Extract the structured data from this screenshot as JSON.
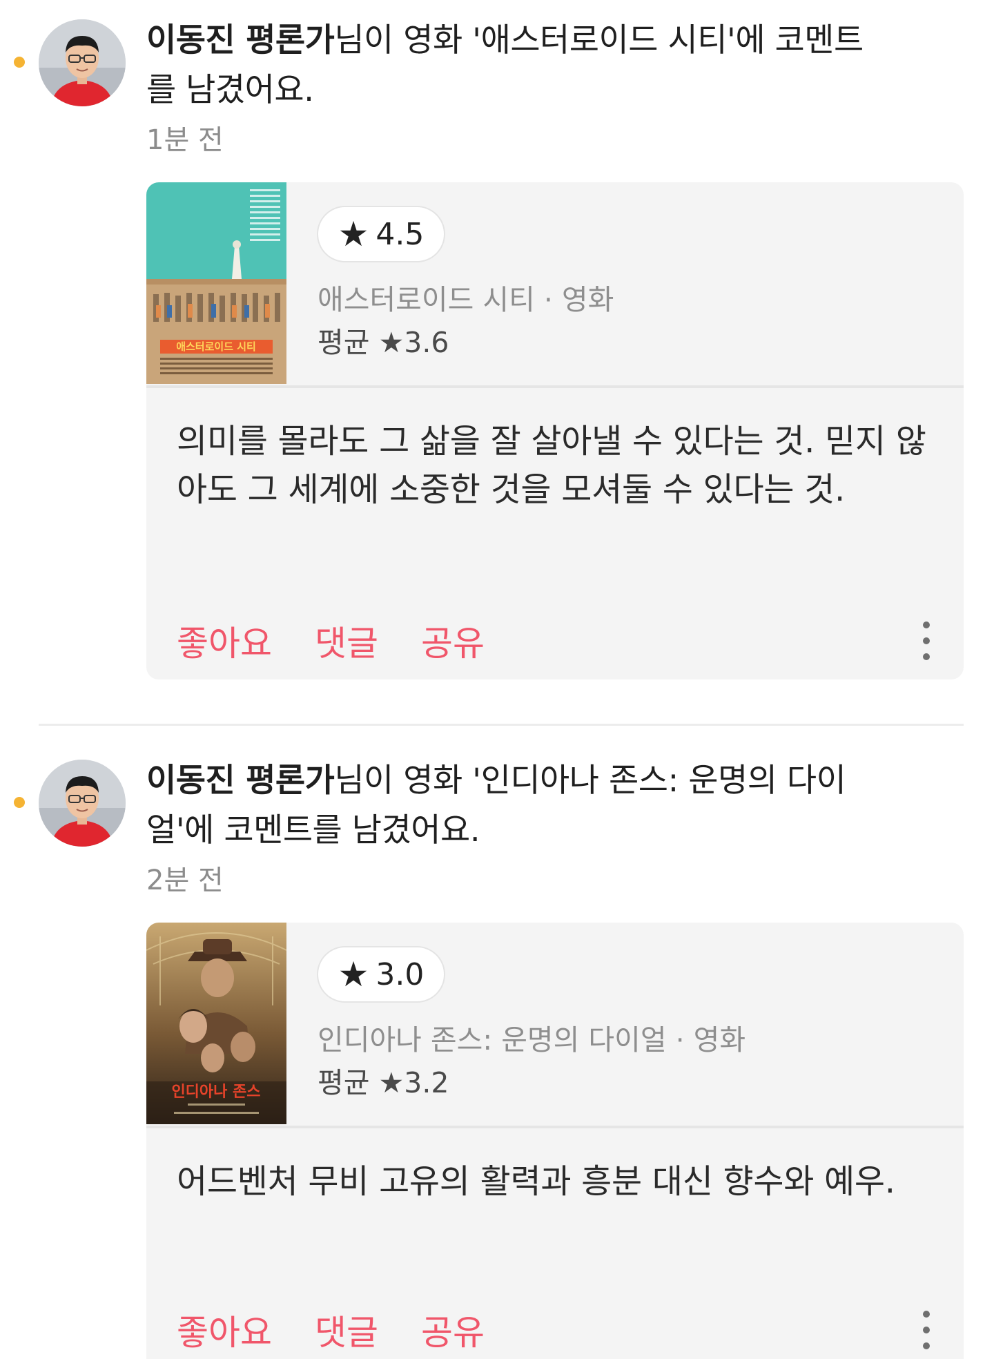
{
  "feed": {
    "items": [
      {
        "author": "이동진 평론가",
        "headline_rest": "님이 영화 '애스터로이드 시티'에 코멘트를 남겼어요.",
        "time": "1분 전",
        "rating": "4.5",
        "star": "★",
        "movie_meta": "애스터로이드 시티 · 영화",
        "avg": "평균 ★3.6",
        "poster_title": "애스터로이드 시티",
        "comment": "의미를 몰라도 그 삶을 잘 살아낼 수 있다는 것. 믿지 않아도 그 세계에 소중한 것을 모셔둘 수 있다는 것.",
        "like_label": "좋아요",
        "comment_label": "댓글",
        "share_label": "공유"
      },
      {
        "author": "이동진 평론가",
        "headline_rest": "님이 영화 '인디아나 존스: 운명의 다이얼'에 코멘트를 남겼어요.",
        "time": "2분 전",
        "rating": "3.0",
        "star": "★",
        "movie_meta": "인디아나 존스: 운명의 다이얼 · 영화",
        "avg": "평균 ★3.2",
        "poster_title": "인디아나 존스",
        "comment": "어드벤처 무비 고유의 활력과 흥분 대신 향수와 예우.",
        "like_label": "좋아요",
        "comment_label": "댓글",
        "share_label": "공유"
      }
    ]
  },
  "colors": {
    "unread_dot": "#f5b333",
    "action": "#f0566a",
    "card_bg": "#f4f4f4",
    "muted_text": "#8c8c8c"
  }
}
